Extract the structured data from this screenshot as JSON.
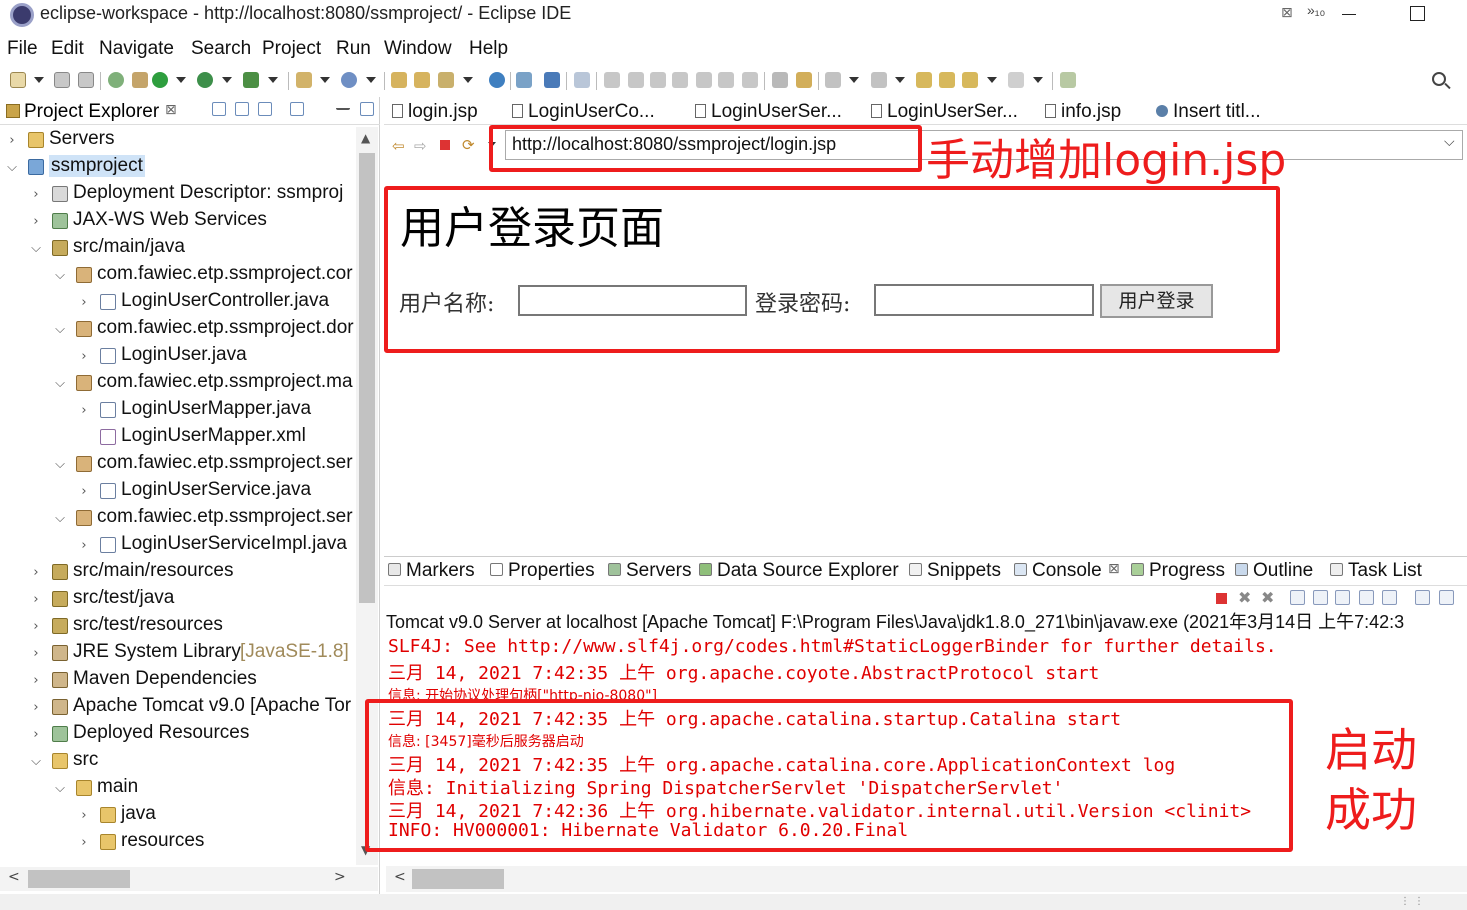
{
  "window": {
    "title": "eclipse-workspace - http://localhost:8080/ssmproject/ - Eclipse IDE"
  },
  "menu": [
    "File",
    "Edit",
    "Navigate",
    "Search",
    "Project",
    "Run",
    "Window",
    "Help"
  ],
  "project_explorer": {
    "title": "Project Explorer",
    "close_glyph": "⊠",
    "tree": [
      {
        "twisty": ">",
        "label": "Servers",
        "icon": "folder-icon"
      },
      {
        "twisty": "v",
        "label": "ssmproject",
        "icon": "project-icon"
      },
      {
        "twisty": ">",
        "label": "Deployment Descriptor: ssmproj",
        "icon": "descriptor-icon"
      },
      {
        "twisty": ">",
        "label": "JAX-WS Web Services",
        "icon": "webservice-icon"
      },
      {
        "twisty": "v",
        "label": "src/main/java",
        "icon": "source-folder-icon"
      },
      {
        "twisty": "v",
        "label": "com.fawiec.etp.ssmproject.cor",
        "icon": "package-icon"
      },
      {
        "twisty": ">",
        "label": "LoginUserController.java",
        "icon": "java-file-icon"
      },
      {
        "twisty": "v",
        "label": "com.fawiec.etp.ssmproject.dor",
        "icon": "package-icon"
      },
      {
        "twisty": ">",
        "label": "LoginUser.java",
        "icon": "java-file-icon"
      },
      {
        "twisty": "v",
        "label": "com.fawiec.etp.ssmproject.ma",
        "icon": "package-icon"
      },
      {
        "twisty": ">",
        "label": "LoginUserMapper.java",
        "icon": "java-interface-icon"
      },
      {
        "twisty": "",
        "label": "LoginUserMapper.xml",
        "icon": "xml-file-icon"
      },
      {
        "twisty": "v",
        "label": "com.fawiec.etp.ssmproject.ser",
        "icon": "package-icon"
      },
      {
        "twisty": ">",
        "label": "LoginUserService.java",
        "icon": "java-interface-icon"
      },
      {
        "twisty": "v",
        "label": "com.fawiec.etp.ssmproject.ser",
        "icon": "package-icon"
      },
      {
        "twisty": ">",
        "label": "LoginUserServiceImpl.java",
        "icon": "java-file-icon"
      },
      {
        "twisty": ">",
        "label": "src/main/resources",
        "icon": "source-folder-icon"
      },
      {
        "twisty": ">",
        "label": "src/test/java",
        "icon": "source-folder-icon"
      },
      {
        "twisty": ">",
        "label": "src/test/resources",
        "icon": "source-folder-icon"
      },
      {
        "twisty": ">",
        "label": "JRE System Library",
        "decoration": "[JavaSE-1.8]",
        "icon": "library-icon"
      },
      {
        "twisty": ">",
        "label": "Maven Dependencies",
        "icon": "library-icon"
      },
      {
        "twisty": ">",
        "label": "Apache Tomcat v9.0 [Apache Tor",
        "icon": "library-icon"
      },
      {
        "twisty": ">",
        "label": "Deployed Resources",
        "icon": "deployed-resources-icon"
      },
      {
        "twisty": "v",
        "label": "src",
        "icon": "folder-icon"
      },
      {
        "twisty": "v",
        "label": "main",
        "icon": "folder-icon"
      },
      {
        "twisty": ">",
        "label": "java",
        "icon": "folder-icon"
      },
      {
        "twisty": ">",
        "label": "resources",
        "icon": "folder-icon"
      }
    ]
  },
  "editor_tabs": [
    {
      "label": "login.jsp",
      "icon": "jsp-file-icon"
    },
    {
      "label": "LoginUserCo...",
      "icon": "java-file-icon"
    },
    {
      "label": "LoginUserSer...",
      "icon": "java-file-icon"
    },
    {
      "label": "LoginUserSer...",
      "icon": "java-file-icon"
    },
    {
      "label": "info.jsp",
      "icon": "jsp-file-icon"
    },
    {
      "label": "Insert titl...",
      "icon": "globe-icon",
      "active": true
    }
  ],
  "editor_tab_overflow": "»₁₀",
  "editor_tab_close": "⊠",
  "browser": {
    "url": "http://localhost:8080/ssmproject/login.jsp"
  },
  "login_page": {
    "heading": "用户登录页面",
    "username_label": "用户名称:",
    "password_label": "登录密码:",
    "username_value": "",
    "password_value": "",
    "submit_label": "用户登录"
  },
  "bottom_tabs": [
    {
      "label": "Markers",
      "icon": "markers-icon"
    },
    {
      "label": "Properties",
      "icon": "properties-icon"
    },
    {
      "label": "Servers",
      "icon": "servers-icon"
    },
    {
      "label": "Data Source Explorer",
      "icon": "datasource-icon"
    },
    {
      "label": "Snippets",
      "icon": "snippets-icon"
    },
    {
      "label": "Console",
      "icon": "console-icon",
      "active": true
    },
    {
      "label": "Progress",
      "icon": "progress-icon"
    },
    {
      "label": "Outline",
      "icon": "outline-icon"
    },
    {
      "label": "Task List",
      "icon": "tasklist-icon"
    }
  ],
  "console": {
    "description": "Tomcat v9.0 Server at localhost [Apache Tomcat] F:\\Program Files\\Java\\jdk1.8.0_271\\bin\\javaw.exe  (2021年3月14日 上午7:42:3",
    "lines": [
      {
        "text": "SLF4J: See http://www.slf4j.org/codes.html#StaticLoggerBinder for further details.",
        "small": false
      },
      {
        "text": "三月 14, 2021 7:42:35 上午 org.apache.coyote.AbstractProtocol start",
        "small": false
      },
      {
        "text": "信息: 开始协议处理句柄[\"http-nio-8080\"]",
        "small": true
      },
      {
        "text": "三月 14, 2021 7:42:35 上午 org.apache.catalina.startup.Catalina start",
        "small": false
      },
      {
        "text": "信息: [3457]毫秒后服务器启动",
        "small": true
      },
      {
        "text": "三月 14, 2021 7:42:35 上午 org.apache.catalina.core.ApplicationContext log",
        "small": false
      },
      {
        "text": "信息: Initializing Spring DispatcherServlet 'DispatcherServlet'",
        "small": false
      },
      {
        "text": "三月 14, 2021 7:42:36 上午 org.hibernate.validator.internal.util.Version <clinit>",
        "small": false
      },
      {
        "text": "INFO: HV000001: Hibernate Validator 6.0.20.Final",
        "small": false
      }
    ]
  },
  "annotations": {
    "url_note": "手动增加login.jsp",
    "startup_note_line1": "启动",
    "startup_note_line2": "成功",
    "color": "#ee1c1c"
  },
  "colors": {
    "console_text": "#e00000",
    "selection": "#cfe3f7"
  }
}
